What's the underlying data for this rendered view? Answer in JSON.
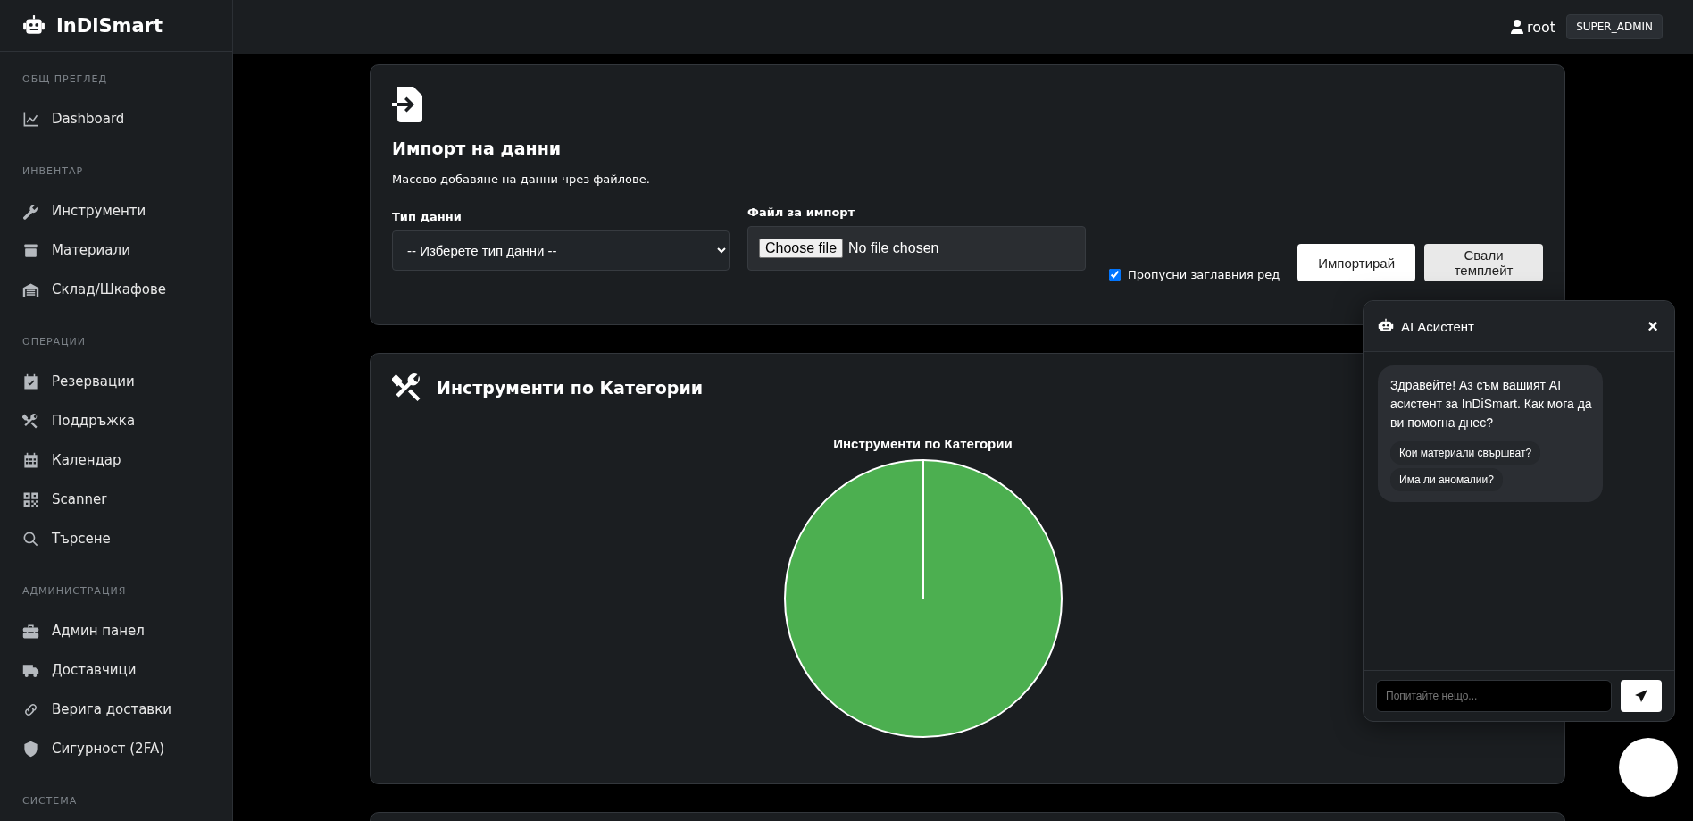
{
  "brand": {
    "name": "InDiSmart"
  },
  "sidebar": {
    "sections": [
      {
        "heading": "ОБЩ ПРЕГЛЕД",
        "items": [
          {
            "label": "Dashboard"
          }
        ]
      },
      {
        "heading": "ИНВЕНТАР",
        "items": [
          {
            "label": "Инструменти"
          },
          {
            "label": "Материали"
          },
          {
            "label": "Склад/Шкафове"
          }
        ]
      },
      {
        "heading": "ОПЕРАЦИИ",
        "items": [
          {
            "label": "Резервации"
          },
          {
            "label": "Поддръжка"
          },
          {
            "label": "Календар"
          },
          {
            "label": "Scanner"
          },
          {
            "label": "Търсене"
          }
        ]
      },
      {
        "heading": "АДМИНИСТРАЦИЯ",
        "items": [
          {
            "label": "Админ панел"
          },
          {
            "label": "Доставчици"
          },
          {
            "label": "Верига доставки"
          },
          {
            "label": "Сигурност (2FA)"
          }
        ]
      },
      {
        "heading": "СИСТЕМА"
      }
    ]
  },
  "topbar": {
    "user": "root",
    "role": "SUPER_ADMIN"
  },
  "import_card": {
    "title": "Импорт на данни",
    "description": "Масово добавяне на данни чрез файлове.",
    "type_field": {
      "label": "Тип данни",
      "value": "-- Изберете тип данни --"
    },
    "file_field": {
      "label": "Файл за импорт",
      "button": "Choose file",
      "value": "No file chosen"
    },
    "skip_header": {
      "label": "Пропусни заглавния ред",
      "checked": true
    },
    "buttons": [
      "Импортирай",
      "Свали темплейт"
    ]
  },
  "chart_card": {
    "title": "Инструменти по Категории",
    "chart_title": "Инструменти по Категории"
  },
  "chat": {
    "title": "AI Асистент",
    "close": "×",
    "message": "Здравейте! Аз съм вашият AI асистент за InDiSmart. Как мога да ви помогна днес?",
    "suggestions": [
      "Кои материали свършват?",
      "Има ли аномалии?"
    ],
    "placeholder": "Попитайте нещо..."
  }
}
